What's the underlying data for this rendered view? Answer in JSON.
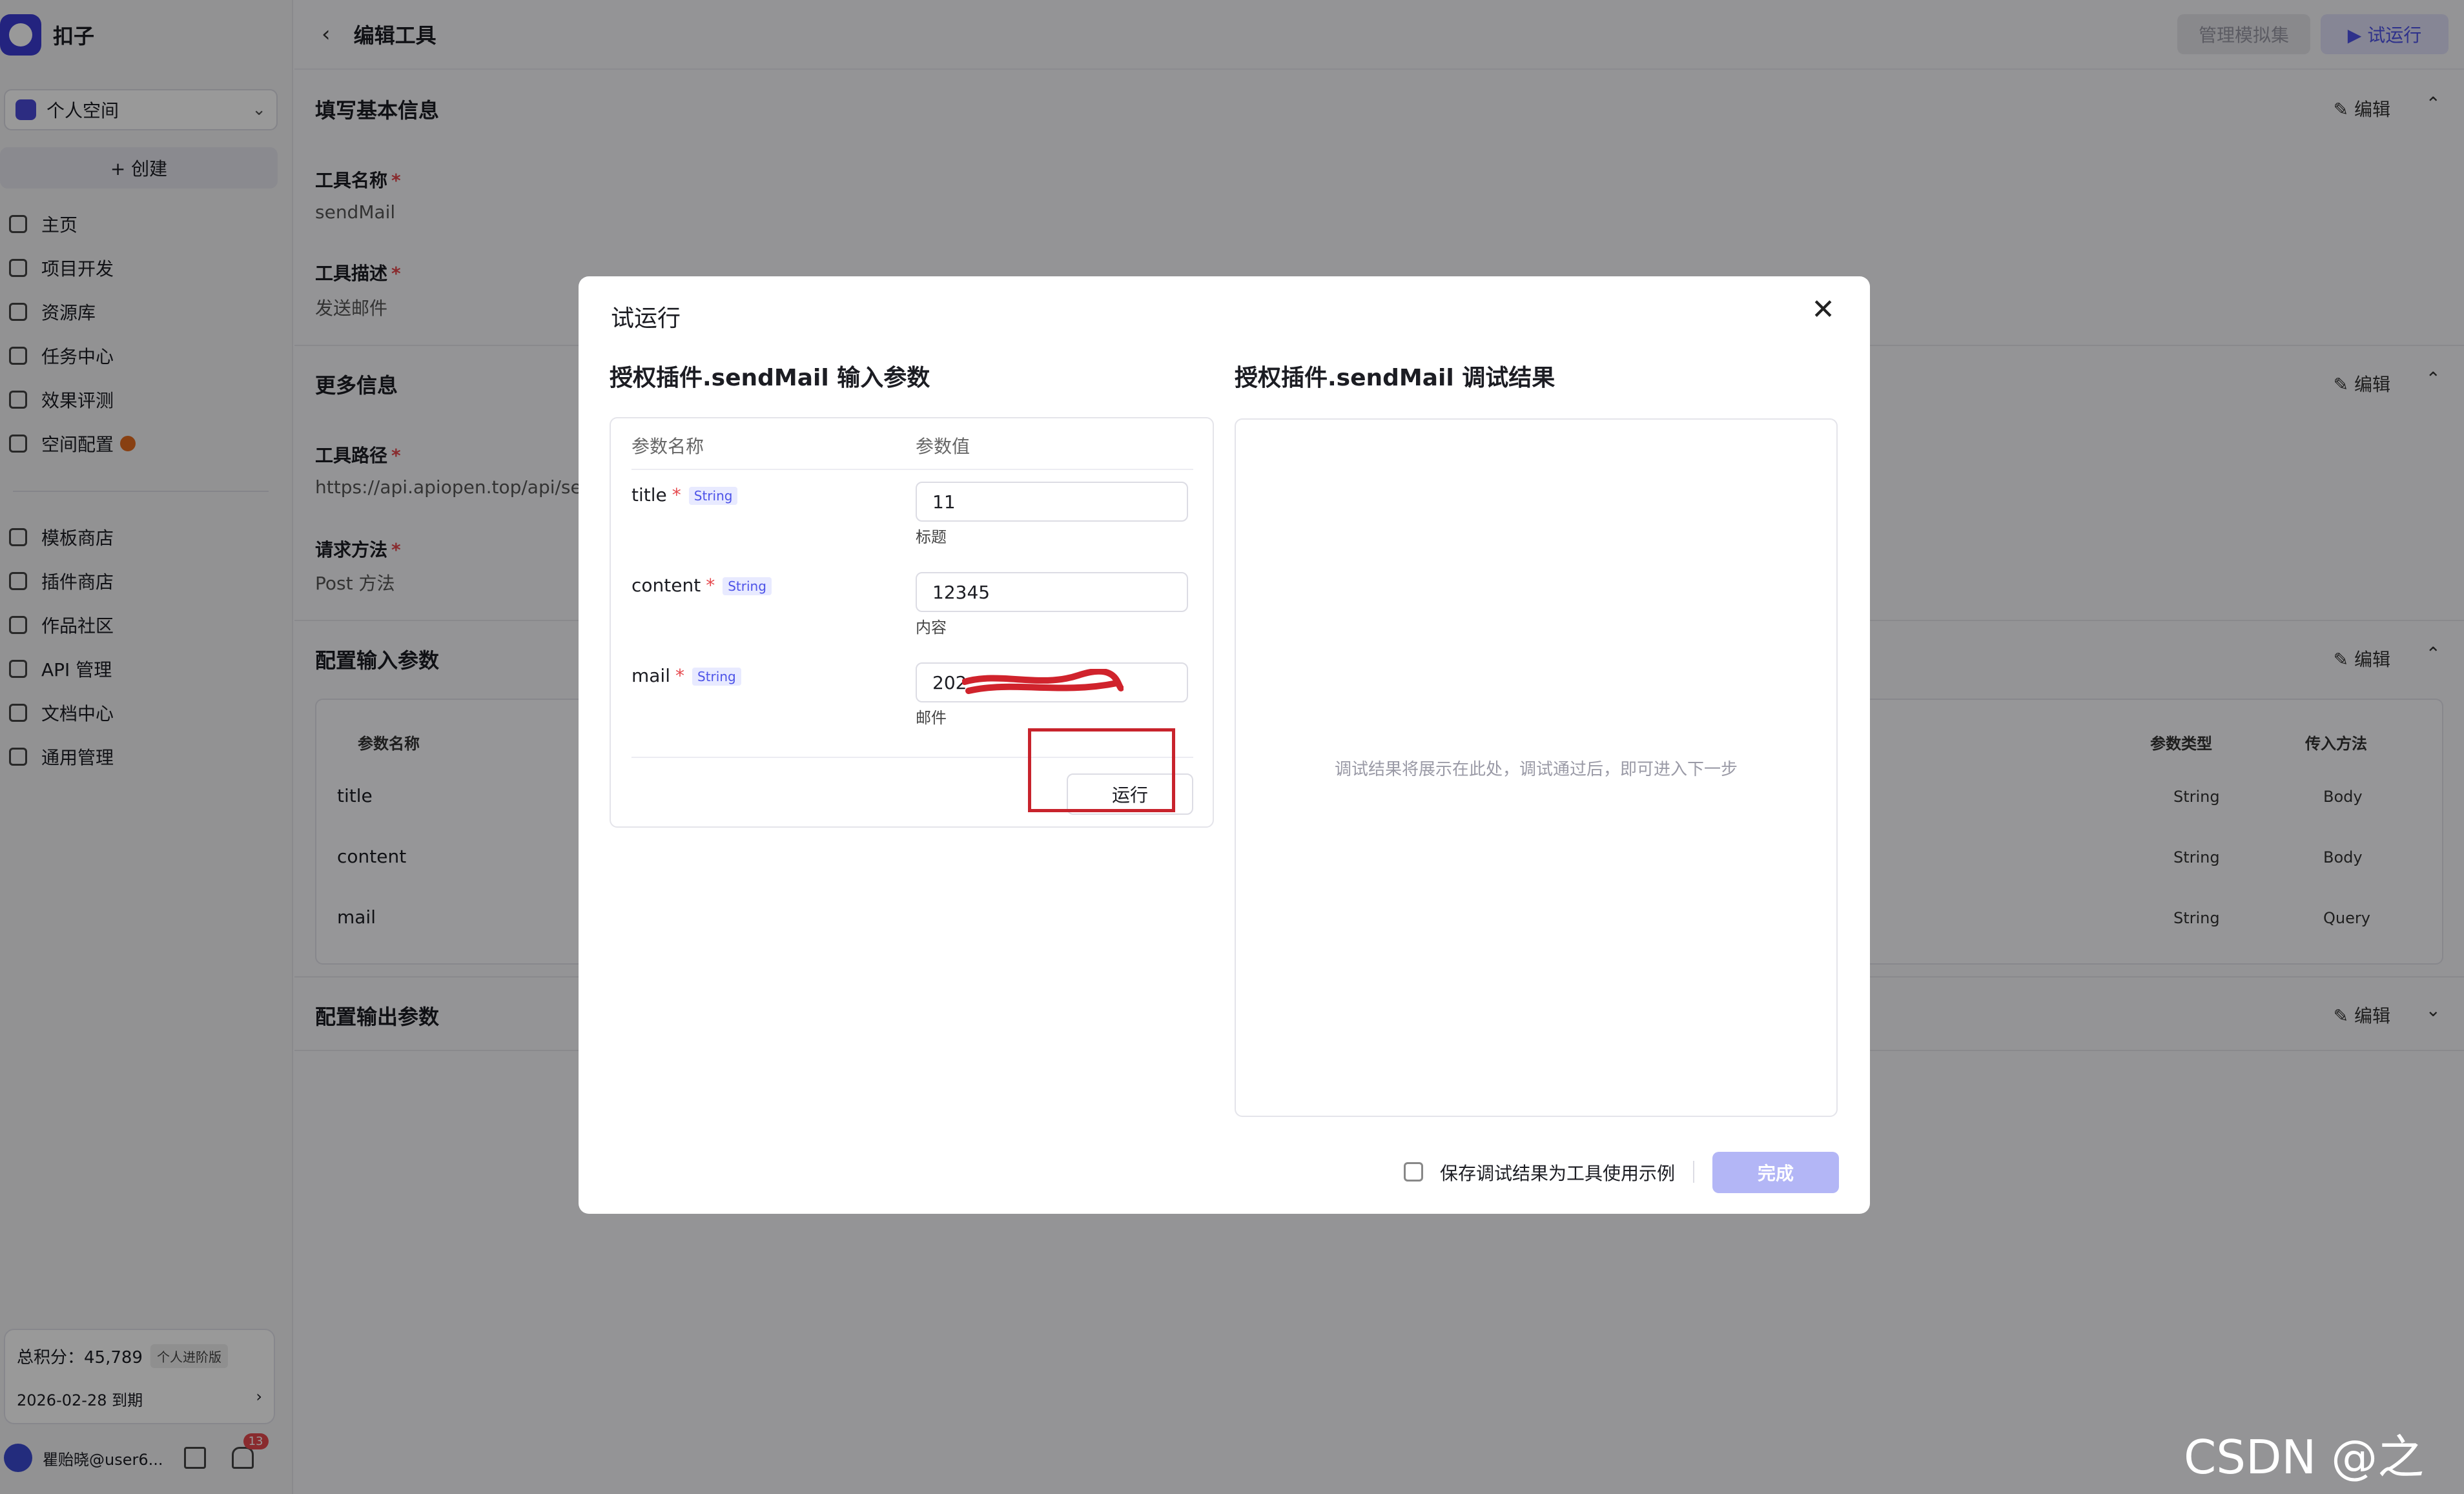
{
  "sidebar": {
    "app_name": "扣子",
    "space": "个人空间",
    "create": "+ 创建",
    "nav_main": [
      "主页",
      "项目开发",
      "资源库",
      "任务中心",
      "效果评测",
      "空间配置"
    ],
    "nav_more": [
      "模板商店",
      "插件商店",
      "作品社区",
      "API 管理",
      "文档中心",
      "通用管理"
    ],
    "points_label": "总积分：45,789",
    "points_badge": "个人进阶版",
    "expiry": "2026-02-28 到期",
    "user": "瞿贻晓@user6...",
    "notification_count": "13"
  },
  "header": {
    "title": "编辑工具",
    "manage_btn": "管理模拟集",
    "run_btn": "▶ 试运行"
  },
  "basic": {
    "title": "填写基本信息",
    "edit": "编辑",
    "name_label": "工具名称",
    "name_value": "sendMail",
    "desc_label": "工具描述",
    "desc_value": "发送邮件"
  },
  "more": {
    "title": "更多信息",
    "edit": "编辑",
    "path_label": "工具路径",
    "path_value": "https://api.apiopen.top/api/se",
    "method_label": "请求方法",
    "method_value": "Post 方法"
  },
  "input_params": {
    "title": "配置输入参数",
    "edit": "编辑",
    "col_name": "参数名称",
    "col_type": "参数类型",
    "col_method": "传入方法",
    "rows": [
      {
        "name": "title",
        "type": "String",
        "method": "Body"
      },
      {
        "name": "content",
        "type": "String",
        "method": "Body"
      },
      {
        "name": "mail",
        "type": "String",
        "method": "Query"
      }
    ]
  },
  "output_params": {
    "title": "配置输出参数",
    "edit": "编辑"
  },
  "modal": {
    "title": "试运行",
    "left_title": "授权插件.sendMail 输入参数",
    "right_title": "授权插件.sendMail 调试结果",
    "col_name": "参数名称",
    "col_value": "参数值",
    "params": [
      {
        "name": "title",
        "type": "String",
        "value": "11",
        "hint": "标题"
      },
      {
        "name": "content",
        "type": "String",
        "value": "12345",
        "hint": "内容"
      },
      {
        "name": "mail",
        "type": "String",
        "value": "202",
        "hint": "邮件"
      }
    ],
    "run": "运行",
    "result_placeholder": "调试结果将展示在此处，调试通过后，即可进入下一步",
    "save_example": "保存调试结果为工具使用示例",
    "done": "完成"
  },
  "watermark": "CSDN @之歆"
}
